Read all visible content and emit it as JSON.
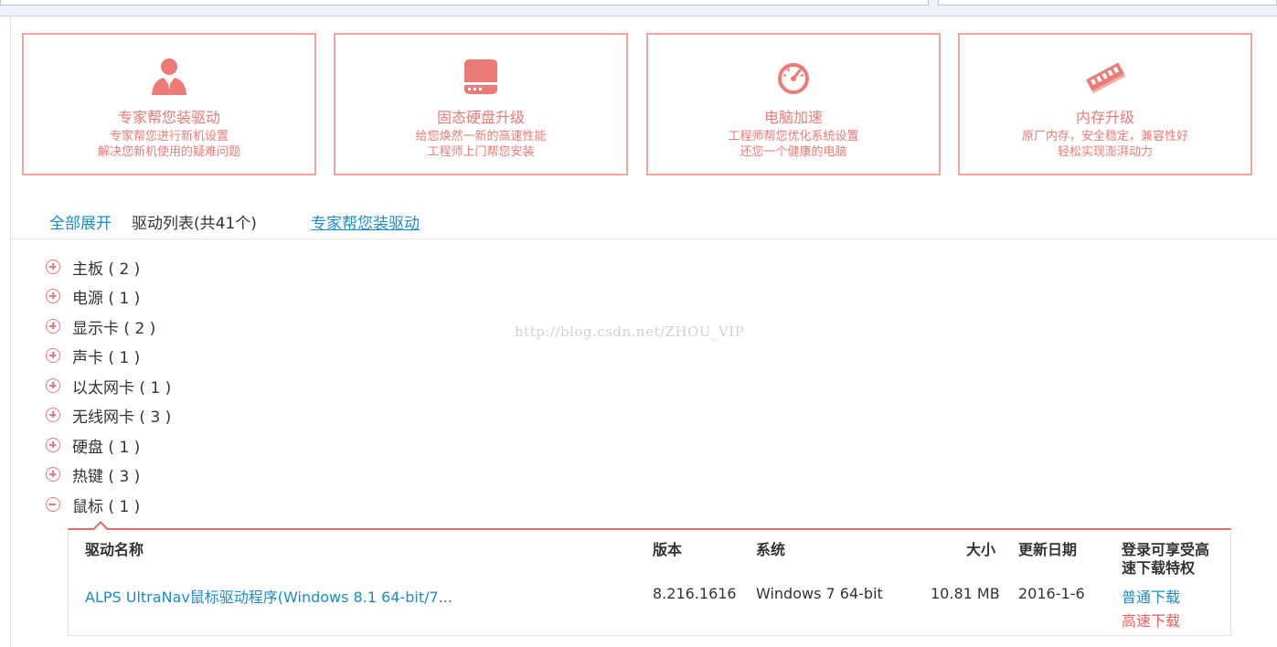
{
  "cards": [
    {
      "icon": "person-icon",
      "title": "专家帮您装驱动",
      "desc_lines": [
        "专家帮您进行新机设置",
        "解决您新机使用的疑难问题"
      ]
    },
    {
      "icon": "ssd-icon",
      "title": "固态硬盘升级",
      "desc_lines": [
        "给您焕然一新的高速性能",
        "工程师上门帮您安装"
      ]
    },
    {
      "icon": "speedometer-icon",
      "title": "电脑加速",
      "desc_lines": [
        "工程师帮您优化系统设置",
        "还您一个健康的电脑"
      ]
    },
    {
      "icon": "memory-icon",
      "title": "内存升级",
      "desc_lines": [
        "原厂内存，安全稳定，兼容性好",
        "轻松实现澎湃动力"
      ]
    }
  ],
  "tabs": {
    "expand_all": "全部展开",
    "driver_list": "驱动列表(共41个)",
    "expert_install": "专家帮您装驱动"
  },
  "categories": [
    {
      "label": "主板 ( 2 )",
      "state": "collapsed"
    },
    {
      "label": "电源 ( 1 )",
      "state": "collapsed"
    },
    {
      "label": "显示卡 ( 2 )",
      "state": "collapsed"
    },
    {
      "label": "声卡 ( 1 )",
      "state": "collapsed"
    },
    {
      "label": "以太网卡 ( 1 )",
      "state": "collapsed"
    },
    {
      "label": "无线网卡 ( 3 )",
      "state": "collapsed"
    },
    {
      "label": "硬盘 ( 1 )",
      "state": "collapsed"
    },
    {
      "label": "热键 ( 3 )",
      "state": "collapsed"
    },
    {
      "label": "鼠标 ( 1 )",
      "state": "expanded"
    }
  ],
  "watermark": "http://blog.csdn.net/ZHOU_VIP",
  "table": {
    "headers": {
      "name": "驱动名称",
      "version": "版本",
      "system": "系统",
      "size": "大小",
      "date": "更新日期",
      "login_line1": "登录可享受高",
      "login_line2": "速下载特权"
    },
    "row": {
      "name": "ALPS UltraNav鼠标驱动程序(Windows 8.1 64-bit/7...",
      "version": "8.216.1616",
      "system": "Windows 7 64-bit",
      "size": "10.81 MB",
      "date": "2016-1-6",
      "normal_download": "普通下载",
      "fast_download": "高速下载"
    }
  },
  "colors": {
    "accent_red": "#ec7a76",
    "link_blue": "#1a8cc8",
    "border_red": "#f1a4a2"
  }
}
